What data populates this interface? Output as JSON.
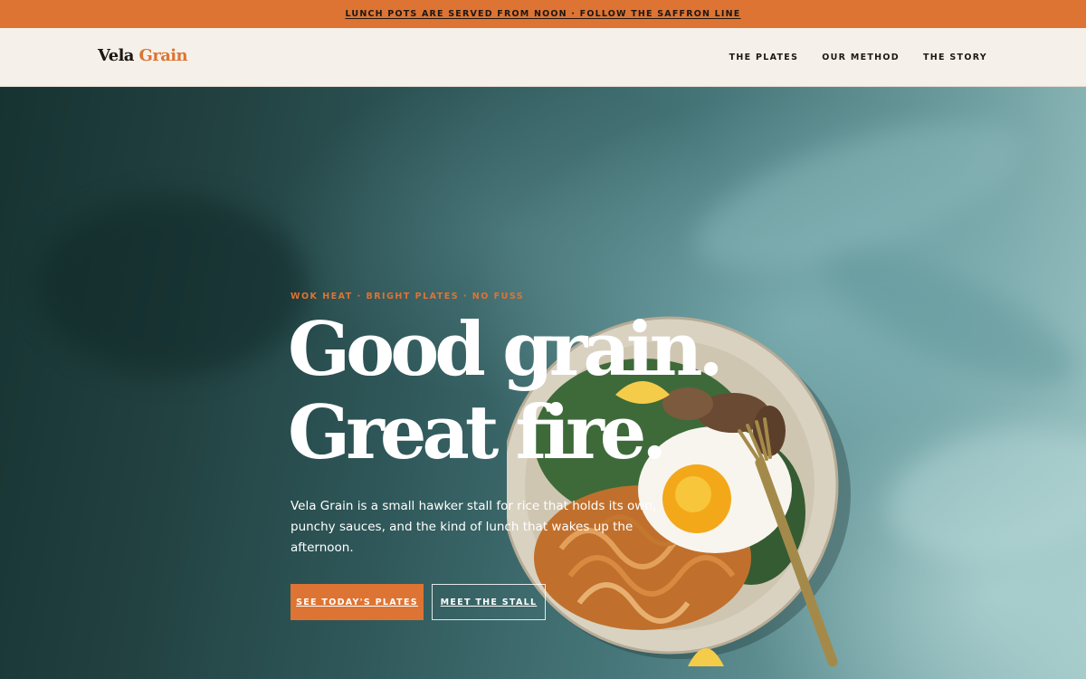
{
  "announcement": {
    "text": "LUNCH POTS ARE SERVED FROM NOON · FOLLOW THE SAFFRON LINE"
  },
  "header": {
    "logo_part1": "Vela",
    "logo_part2": "Grain",
    "nav": [
      {
        "label": "THE PLATES"
      },
      {
        "label": "OUR METHOD"
      },
      {
        "label": "THE STORY"
      }
    ]
  },
  "hero": {
    "eyebrow": "WOK HEAT · BRIGHT PLATES · NO FUSS",
    "headline_line1": "Good grain.",
    "headline_line2": "Great fire.",
    "intro": "Vela Grain is a small hawker stall for rice that holds its own, punchy sauces, and the kind of lunch that wakes up the afternoon.",
    "primary_cta": "SEE TODAY'S PLATES",
    "secondary_cta": "MEET THE STALL",
    "image_subject": "plate-of-noodles-with-fried-egg-and-fork"
  },
  "colors": {
    "accent": "#dd7433",
    "header_bg": "#f5f1ea",
    "text_dark": "#1d1712",
    "hero_teal": "#2f5559"
  }
}
